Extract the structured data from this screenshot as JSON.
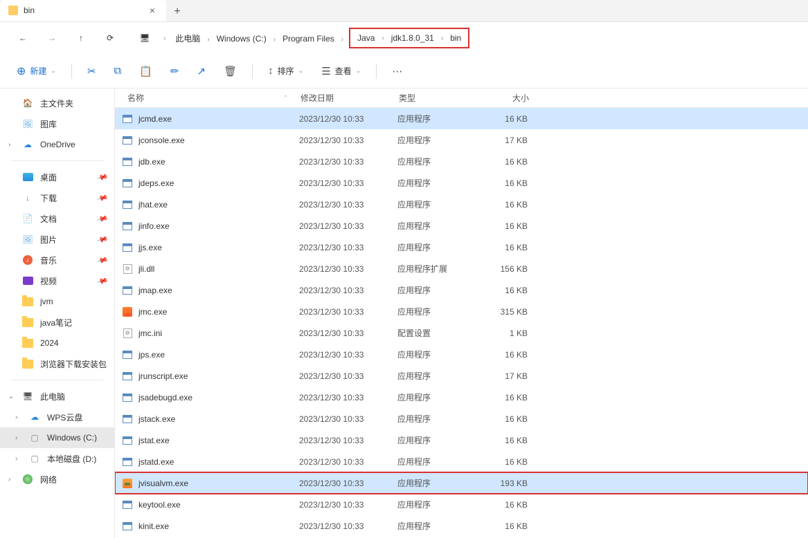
{
  "tab": {
    "title": "bin"
  },
  "breadcrumb": [
    "此电脑",
    "Windows (C:)",
    "Program Files",
    "Java",
    "jdk1.8.0_31",
    "bin"
  ],
  "breadcrumb_highlight_from": 3,
  "toolbar": {
    "new": "新建",
    "sort": "排序",
    "view": "查看"
  },
  "sidebar": {
    "top": [
      {
        "label": "主文件夹",
        "icon": "home"
      },
      {
        "label": "图库",
        "icon": "pics"
      },
      {
        "label": "OneDrive",
        "icon": "cloud",
        "expandable": true
      }
    ],
    "quick": [
      {
        "label": "桌面",
        "icon": "desk",
        "pin": true
      },
      {
        "label": "下载",
        "icon": "down",
        "pin": true
      },
      {
        "label": "文档",
        "icon": "doc",
        "pin": true
      },
      {
        "label": "图片",
        "icon": "pics",
        "pin": true
      },
      {
        "label": "音乐",
        "icon": "music",
        "pin": true
      },
      {
        "label": "视频",
        "icon": "video",
        "pin": true
      },
      {
        "label": "jvm",
        "icon": "folder"
      },
      {
        "label": "java笔记",
        "icon": "folder"
      },
      {
        "label": "2024",
        "icon": "folder"
      },
      {
        "label": "浏览器下载安装包",
        "icon": "folder"
      }
    ],
    "pc": {
      "label": "此电脑",
      "icon": "pc"
    },
    "drives": [
      {
        "label": "WPS云盘",
        "icon": "wps",
        "expandable": true
      },
      {
        "label": "Windows (C:)",
        "icon": "disk",
        "expandable": true,
        "selected": true
      },
      {
        "label": "本地磁盘 (D:)",
        "icon": "disk",
        "expandable": true
      }
    ],
    "net": {
      "label": "网络",
      "icon": "net",
      "expandable": true
    }
  },
  "columns": {
    "name": "名称",
    "date": "修改日期",
    "type": "类型",
    "size": "大小"
  },
  "files": [
    {
      "name": "jcmd.exe",
      "date": "2023/12/30 10:33",
      "type": "应用程序",
      "size": "16 KB",
      "icon": "exe",
      "selected": true
    },
    {
      "name": "jconsole.exe",
      "date": "2023/12/30 10:33",
      "type": "应用程序",
      "size": "17 KB",
      "icon": "exe"
    },
    {
      "name": "jdb.exe",
      "date": "2023/12/30 10:33",
      "type": "应用程序",
      "size": "16 KB",
      "icon": "exe"
    },
    {
      "name": "jdeps.exe",
      "date": "2023/12/30 10:33",
      "type": "应用程序",
      "size": "16 KB",
      "icon": "exe"
    },
    {
      "name": "jhat.exe",
      "date": "2023/12/30 10:33",
      "type": "应用程序",
      "size": "16 KB",
      "icon": "exe"
    },
    {
      "name": "jinfo.exe",
      "date": "2023/12/30 10:33",
      "type": "应用程序",
      "size": "16 KB",
      "icon": "exe"
    },
    {
      "name": "jjs.exe",
      "date": "2023/12/30 10:33",
      "type": "应用程序",
      "size": "16 KB",
      "icon": "exe"
    },
    {
      "name": "jli.dll",
      "date": "2023/12/30 10:33",
      "type": "应用程序扩展",
      "size": "156 KB",
      "icon": "dll"
    },
    {
      "name": "jmap.exe",
      "date": "2023/12/30 10:33",
      "type": "应用程序",
      "size": "16 KB",
      "icon": "exe"
    },
    {
      "name": "jmc.exe",
      "date": "2023/12/30 10:33",
      "type": "应用程序",
      "size": "315 KB",
      "icon": "jmc"
    },
    {
      "name": "jmc.ini",
      "date": "2023/12/30 10:33",
      "type": "配置设置",
      "size": "1 KB",
      "icon": "ini"
    },
    {
      "name": "jps.exe",
      "date": "2023/12/30 10:33",
      "type": "应用程序",
      "size": "16 KB",
      "icon": "exe"
    },
    {
      "name": "jrunscript.exe",
      "date": "2023/12/30 10:33",
      "type": "应用程序",
      "size": "17 KB",
      "icon": "exe"
    },
    {
      "name": "jsadebugd.exe",
      "date": "2023/12/30 10:33",
      "type": "应用程序",
      "size": "16 KB",
      "icon": "exe"
    },
    {
      "name": "jstack.exe",
      "date": "2023/12/30 10:33",
      "type": "应用程序",
      "size": "16 KB",
      "icon": "exe"
    },
    {
      "name": "jstat.exe",
      "date": "2023/12/30 10:33",
      "type": "应用程序",
      "size": "16 KB",
      "icon": "exe"
    },
    {
      "name": "jstatd.exe",
      "date": "2023/12/30 10:33",
      "type": "应用程序",
      "size": "16 KB",
      "icon": "exe"
    },
    {
      "name": "jvisualvm.exe",
      "date": "2023/12/30 10:33",
      "type": "应用程序",
      "size": "193 KB",
      "icon": "jvm",
      "highlight": true
    },
    {
      "name": "keytool.exe",
      "date": "2023/12/30 10:33",
      "type": "应用程序",
      "size": "16 KB",
      "icon": "exe"
    },
    {
      "name": "kinit.exe",
      "date": "2023/12/30 10:33",
      "type": "应用程序",
      "size": "16 KB",
      "icon": "exe"
    }
  ]
}
